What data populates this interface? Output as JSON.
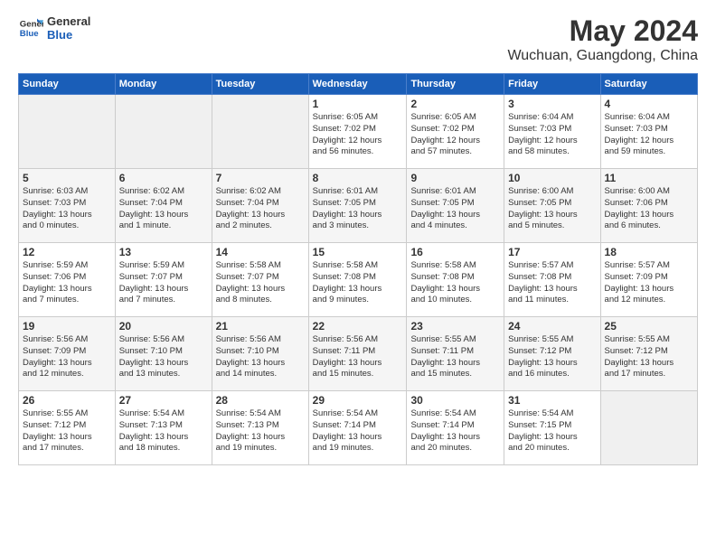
{
  "header": {
    "logo_general": "General",
    "logo_blue": "Blue",
    "title": "May 2024",
    "subtitle": "Wuchuan, Guangdong, China"
  },
  "weekdays": [
    "Sunday",
    "Monday",
    "Tuesday",
    "Wednesday",
    "Thursday",
    "Friday",
    "Saturday"
  ],
  "weeks": [
    [
      {
        "day": "",
        "info": ""
      },
      {
        "day": "",
        "info": ""
      },
      {
        "day": "",
        "info": ""
      },
      {
        "day": "1",
        "info": "Sunrise: 6:05 AM\nSunset: 7:02 PM\nDaylight: 12 hours\nand 56 minutes."
      },
      {
        "day": "2",
        "info": "Sunrise: 6:05 AM\nSunset: 7:02 PM\nDaylight: 12 hours\nand 57 minutes."
      },
      {
        "day": "3",
        "info": "Sunrise: 6:04 AM\nSunset: 7:03 PM\nDaylight: 12 hours\nand 58 minutes."
      },
      {
        "day": "4",
        "info": "Sunrise: 6:04 AM\nSunset: 7:03 PM\nDaylight: 12 hours\nand 59 minutes."
      }
    ],
    [
      {
        "day": "5",
        "info": "Sunrise: 6:03 AM\nSunset: 7:03 PM\nDaylight: 13 hours\nand 0 minutes."
      },
      {
        "day": "6",
        "info": "Sunrise: 6:02 AM\nSunset: 7:04 PM\nDaylight: 13 hours\nand 1 minute."
      },
      {
        "day": "7",
        "info": "Sunrise: 6:02 AM\nSunset: 7:04 PM\nDaylight: 13 hours\nand 2 minutes."
      },
      {
        "day": "8",
        "info": "Sunrise: 6:01 AM\nSunset: 7:05 PM\nDaylight: 13 hours\nand 3 minutes."
      },
      {
        "day": "9",
        "info": "Sunrise: 6:01 AM\nSunset: 7:05 PM\nDaylight: 13 hours\nand 4 minutes."
      },
      {
        "day": "10",
        "info": "Sunrise: 6:00 AM\nSunset: 7:05 PM\nDaylight: 13 hours\nand 5 minutes."
      },
      {
        "day": "11",
        "info": "Sunrise: 6:00 AM\nSunset: 7:06 PM\nDaylight: 13 hours\nand 6 minutes."
      }
    ],
    [
      {
        "day": "12",
        "info": "Sunrise: 5:59 AM\nSunset: 7:06 PM\nDaylight: 13 hours\nand 7 minutes."
      },
      {
        "day": "13",
        "info": "Sunrise: 5:59 AM\nSunset: 7:07 PM\nDaylight: 13 hours\nand 7 minutes."
      },
      {
        "day": "14",
        "info": "Sunrise: 5:58 AM\nSunset: 7:07 PM\nDaylight: 13 hours\nand 8 minutes."
      },
      {
        "day": "15",
        "info": "Sunrise: 5:58 AM\nSunset: 7:08 PM\nDaylight: 13 hours\nand 9 minutes."
      },
      {
        "day": "16",
        "info": "Sunrise: 5:58 AM\nSunset: 7:08 PM\nDaylight: 13 hours\nand 10 minutes."
      },
      {
        "day": "17",
        "info": "Sunrise: 5:57 AM\nSunset: 7:08 PM\nDaylight: 13 hours\nand 11 minutes."
      },
      {
        "day": "18",
        "info": "Sunrise: 5:57 AM\nSunset: 7:09 PM\nDaylight: 13 hours\nand 12 minutes."
      }
    ],
    [
      {
        "day": "19",
        "info": "Sunrise: 5:56 AM\nSunset: 7:09 PM\nDaylight: 13 hours\nand 12 minutes."
      },
      {
        "day": "20",
        "info": "Sunrise: 5:56 AM\nSunset: 7:10 PM\nDaylight: 13 hours\nand 13 minutes."
      },
      {
        "day": "21",
        "info": "Sunrise: 5:56 AM\nSunset: 7:10 PM\nDaylight: 13 hours\nand 14 minutes."
      },
      {
        "day": "22",
        "info": "Sunrise: 5:56 AM\nSunset: 7:11 PM\nDaylight: 13 hours\nand 15 minutes."
      },
      {
        "day": "23",
        "info": "Sunrise: 5:55 AM\nSunset: 7:11 PM\nDaylight: 13 hours\nand 15 minutes."
      },
      {
        "day": "24",
        "info": "Sunrise: 5:55 AM\nSunset: 7:12 PM\nDaylight: 13 hours\nand 16 minutes."
      },
      {
        "day": "25",
        "info": "Sunrise: 5:55 AM\nSunset: 7:12 PM\nDaylight: 13 hours\nand 17 minutes."
      }
    ],
    [
      {
        "day": "26",
        "info": "Sunrise: 5:55 AM\nSunset: 7:12 PM\nDaylight: 13 hours\nand 17 minutes."
      },
      {
        "day": "27",
        "info": "Sunrise: 5:54 AM\nSunset: 7:13 PM\nDaylight: 13 hours\nand 18 minutes."
      },
      {
        "day": "28",
        "info": "Sunrise: 5:54 AM\nSunset: 7:13 PM\nDaylight: 13 hours\nand 19 minutes."
      },
      {
        "day": "29",
        "info": "Sunrise: 5:54 AM\nSunset: 7:14 PM\nDaylight: 13 hours\nand 19 minutes."
      },
      {
        "day": "30",
        "info": "Sunrise: 5:54 AM\nSunset: 7:14 PM\nDaylight: 13 hours\nand 20 minutes."
      },
      {
        "day": "31",
        "info": "Sunrise: 5:54 AM\nSunset: 7:15 PM\nDaylight: 13 hours\nand 20 minutes."
      },
      {
        "day": "",
        "info": ""
      }
    ]
  ]
}
